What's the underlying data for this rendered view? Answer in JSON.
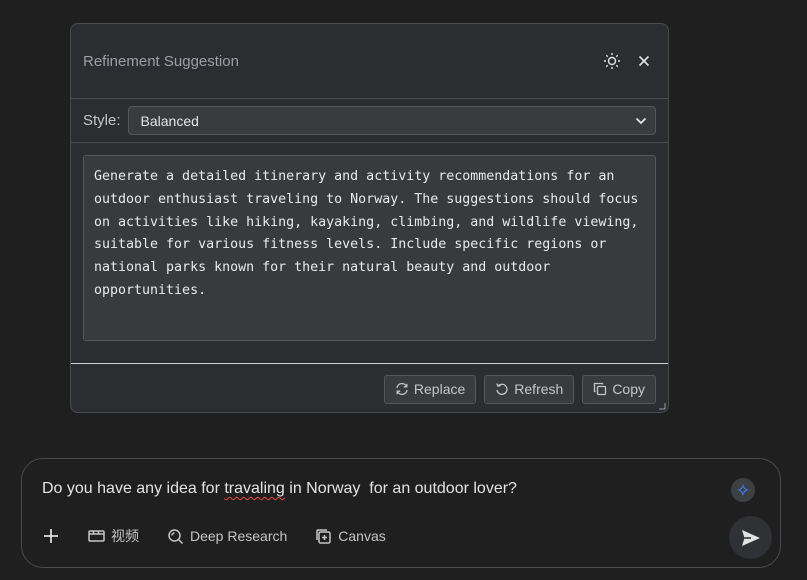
{
  "panel": {
    "title": "Refinement Suggestion",
    "style_label": "Style:",
    "style_selected": "Balanced",
    "suggestion_text": "Generate a detailed itinerary and activity recommendations for an outdoor enthusiast traveling to Norway. The suggestions should focus on activities like hiking, kayaking, climbing, and wildlife viewing, suitable for various fitness levels. Include specific regions or national parks known for their natural beauty and outdoor opportunities.",
    "actions": {
      "replace": "Replace",
      "refresh": "Refresh",
      "copy": "Copy"
    }
  },
  "chat": {
    "prompt_before": "Do you have any idea for ",
    "prompt_misspelled": "travaling",
    "prompt_after": " in Norway  for an outdoor lover?",
    "tools": {
      "video": "视频",
      "deep_research": "Deep Research",
      "canvas": "Canvas"
    }
  },
  "colors": {
    "background": "#1f1f1f",
    "panel": "#2c2d30",
    "accent": "#8ab4f8"
  }
}
